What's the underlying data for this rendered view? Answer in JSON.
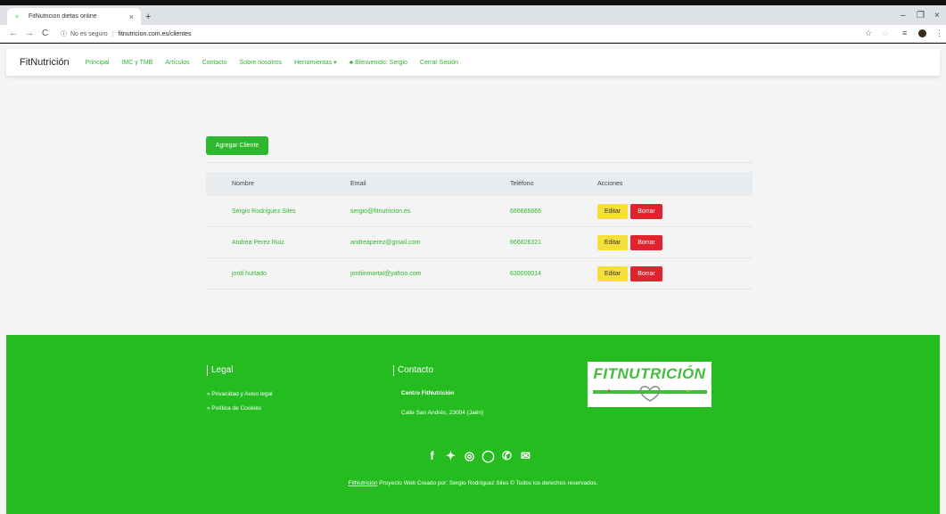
{
  "browser": {
    "tab_title": "FitNutricion dietas online",
    "tab_close": "×",
    "new_tab": "+",
    "insecure_label": "No es seguro",
    "url": "fitnutricion.com.es/clientes",
    "info_icon": "ⓘ",
    "back": "←",
    "forward": "→",
    "reload": "C",
    "star": "☆",
    "minimize": "–",
    "restore": "❐",
    "close": "×"
  },
  "nav": {
    "brand": "FitNutrición",
    "links": [
      "Principal",
      "IMC y TMB",
      "Artículos",
      "Contacto",
      "Sobre nosotros",
      "Herramientas ▾"
    ],
    "user": "♣ Bienvenido: Sergio",
    "logout": "Cerrar Sesión"
  },
  "main": {
    "add_button": "Agregar Cliente",
    "columns": [
      "Nombre",
      "Email",
      "Teléfono",
      "Acciones"
    ],
    "rows": [
      {
        "nombre": "Sergio Rodríguez Siles",
        "email": "sergio@fitnutricion.es",
        "telefono": "666666666"
      },
      {
        "nombre": "Andrea Perez Ruiz",
        "email": "andreaperez@gmail.com",
        "telefono": "666626321"
      },
      {
        "nombre": "jordi hurtado",
        "email": "jordiinmortal@yahoo.com",
        "telefono": "630000014"
      }
    ],
    "edit_label": "Editar",
    "delete_label": "Borrar"
  },
  "footer": {
    "legal_title": "Legal",
    "legal_items": [
      "» Privacidad y Aviso legal",
      "» Política de Cookies"
    ],
    "contact_title": "Contacto",
    "contact_name": "Centro FitNutrición",
    "contact_address": "Calle San Andrés, 23004 (Jaén)",
    "logo_text": "FITNUTRICIÓN",
    "social_icons": [
      "facebook-icon",
      "twitter-icon",
      "instagram-icon",
      "github-icon",
      "whatsapp-icon",
      "email-icon"
    ],
    "social_glyphs": [
      "f",
      "✦",
      "◎",
      "◯",
      "✆",
      "✉"
    ],
    "copy_link": "FitNutrición",
    "copy_text": " Proyecto Web Creado por: Sergio Rodríguez Siles © Todos los derechos reservados."
  },
  "colors": {
    "accent": "#2db82d",
    "footer": "#25bc20",
    "edit": "#f7df3a",
    "delete": "#e0242e"
  }
}
